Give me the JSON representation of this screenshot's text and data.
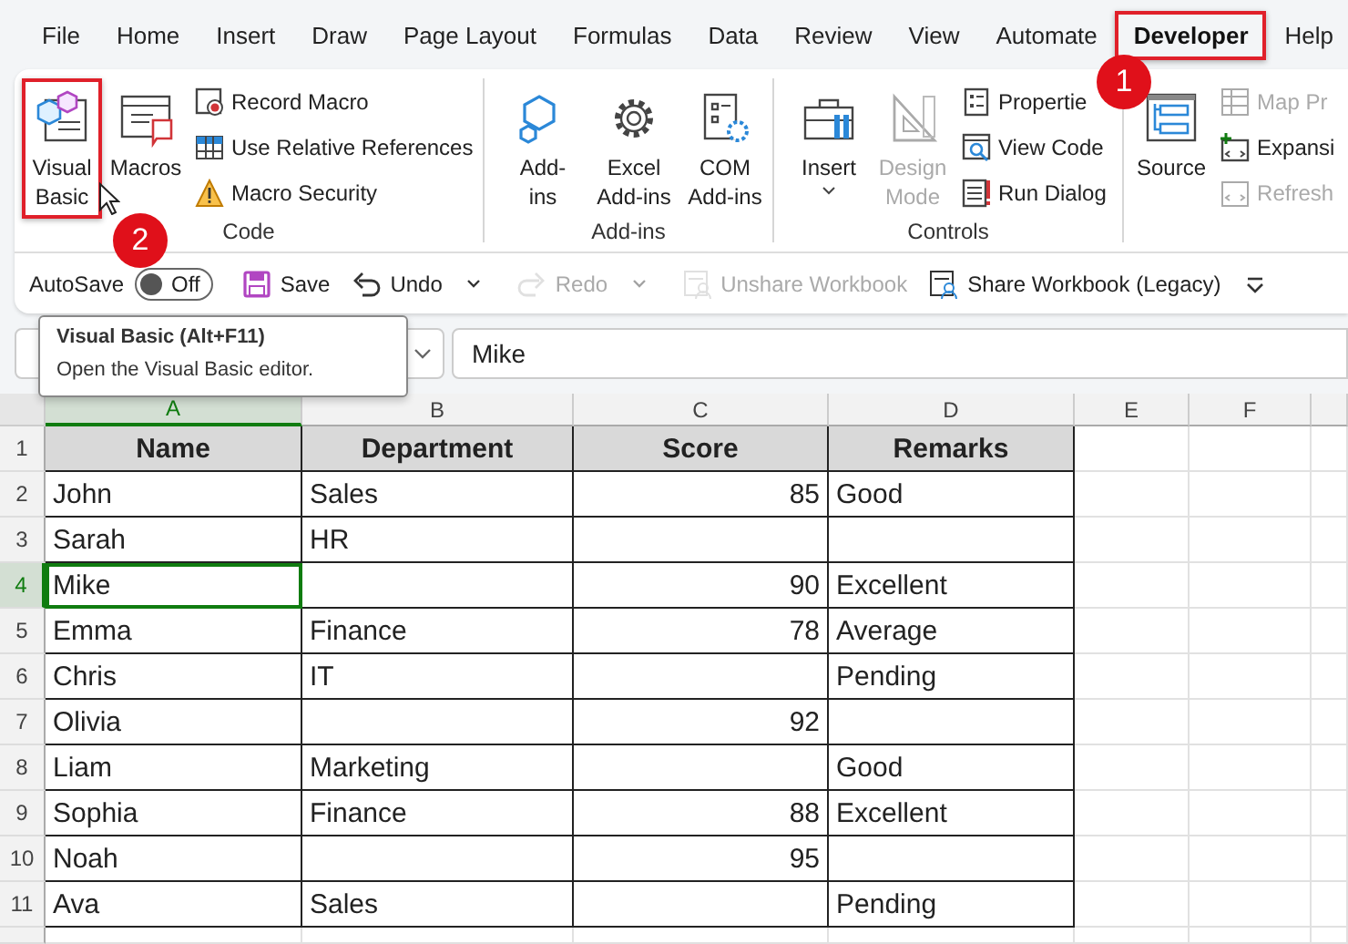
{
  "ribbon_tabs": [
    {
      "label": "File",
      "selected": false,
      "highlighted": false
    },
    {
      "label": "Home",
      "selected": false,
      "highlighted": false
    },
    {
      "label": "Insert",
      "selected": false,
      "highlighted": false
    },
    {
      "label": "Draw",
      "selected": false,
      "highlighted": false
    },
    {
      "label": "Page Layout",
      "selected": false,
      "highlighted": false
    },
    {
      "label": "Formulas",
      "selected": false,
      "highlighted": false
    },
    {
      "label": "Data",
      "selected": false,
      "highlighted": false
    },
    {
      "label": "Review",
      "selected": false,
      "highlighted": false
    },
    {
      "label": "View",
      "selected": false,
      "highlighted": false
    },
    {
      "label": "Automate",
      "selected": false,
      "highlighted": false
    },
    {
      "label": "Developer",
      "selected": true,
      "highlighted": true
    },
    {
      "label": "Help",
      "selected": false,
      "highlighted": false
    }
  ],
  "ribbon_groups": [
    {
      "label": "Code",
      "items": [
        {
          "kind": "large",
          "label": "Visual\nBasic",
          "highlighted": true,
          "disabled": false,
          "dropdown": false
        },
        {
          "kind": "large",
          "label": "Macros",
          "highlighted": false,
          "disabled": false,
          "dropdown": false
        },
        {
          "kind": "small",
          "label": "Record Macro",
          "highlighted": false,
          "disabled": false,
          "dropdown": false
        },
        {
          "kind": "small",
          "label": "Use Relative References",
          "highlighted": false,
          "disabled": false,
          "dropdown": false
        },
        {
          "kind": "small",
          "label": "Macro Security",
          "highlighted": false,
          "disabled": false,
          "dropdown": false
        }
      ]
    },
    {
      "label": "Add-ins",
      "items": [
        {
          "kind": "large",
          "label": "Add-\nins",
          "highlighted": false,
          "disabled": false,
          "dropdown": false
        },
        {
          "kind": "large",
          "label": "Excel\nAdd-ins",
          "highlighted": false,
          "disabled": false,
          "dropdown": false
        },
        {
          "kind": "large",
          "label": "COM\nAdd-ins",
          "highlighted": false,
          "disabled": false,
          "dropdown": false
        }
      ]
    },
    {
      "label": "Controls",
      "items": [
        {
          "kind": "large",
          "label": "Insert",
          "highlighted": false,
          "disabled": false,
          "dropdown": true
        },
        {
          "kind": "large",
          "label": "Design\nMode",
          "highlighted": false,
          "disabled": true,
          "dropdown": false
        },
        {
          "kind": "small",
          "label": "Propertie",
          "highlighted": false,
          "disabled": false,
          "dropdown": false
        },
        {
          "kind": "small",
          "label": "View Code",
          "highlighted": false,
          "disabled": false,
          "dropdown": false
        },
        {
          "kind": "small",
          "label": "Run Dialog",
          "highlighted": false,
          "disabled": false,
          "dropdown": false
        }
      ]
    },
    {
      "items": [
        {
          "kind": "large",
          "label": "Source",
          "highlighted": false,
          "disabled": false,
          "dropdown": false
        },
        {
          "kind": "small",
          "label": "Map Pr",
          "highlighted": false,
          "disabled": true,
          "dropdown": false
        },
        {
          "kind": "small",
          "label": "Expansi",
          "highlighted": false,
          "disabled": false,
          "dropdown": false
        },
        {
          "kind": "small",
          "label": "Refresh",
          "highlighted": false,
          "disabled": true,
          "dropdown": false
        }
      ]
    }
  ],
  "quick_access": {
    "autosave_label": "AutoSave",
    "autosave_toggle": {
      "on": false,
      "label": "Off"
    },
    "buttons": [
      {
        "kind": "save",
        "label": "Save",
        "disabled": false,
        "dropdown": false
      },
      {
        "kind": "undo",
        "label": "Undo",
        "disabled": false,
        "dropdown": true
      },
      {
        "kind": "redo",
        "label": "Redo",
        "disabled": true,
        "dropdown": true
      },
      {
        "kind": "unshare",
        "label": "Unshare Workbook",
        "disabled": true,
        "dropdown": false
      },
      {
        "kind": "share",
        "label": "Share Workbook (Legacy)",
        "disabled": false,
        "dropdown": false
      },
      {
        "kind": "customize",
        "disabled": false,
        "dropdown": false
      }
    ]
  },
  "formula_bar": {
    "value": "Mike"
  },
  "tooltip": {
    "title": "Visual Basic (Alt+F11)",
    "description": "Open the Visual Basic editor."
  },
  "callouts": [
    {
      "number": "1"
    },
    {
      "number": "2"
    }
  ],
  "sheet": {
    "columns": [
      {
        "label": "A",
        "selected": true
      },
      {
        "label": "B",
        "selected": false
      },
      {
        "label": "C",
        "selected": false
      },
      {
        "label": "D",
        "selected": false
      },
      {
        "label": "E",
        "selected": false
      },
      {
        "label": "F",
        "selected": false
      }
    ],
    "rows": [
      {
        "number": "1",
        "kind": "header",
        "selected": false,
        "cells": {
          "A": "Name",
          "B": "Department",
          "C": "Score",
          "D": "Remarks"
        }
      },
      {
        "number": "2",
        "kind": "data",
        "selected": false,
        "cells": {
          "A": "John",
          "B": "Sales",
          "C": "85",
          "D": "Good"
        }
      },
      {
        "number": "3",
        "kind": "data",
        "selected": false,
        "cells": {
          "A": "Sarah",
          "B": "HR"
        }
      },
      {
        "number": "4",
        "kind": "data",
        "selected": true,
        "cells": {
          "A": "Mike",
          "C": "90",
          "D": "Excellent"
        }
      },
      {
        "number": "5",
        "kind": "data",
        "selected": false,
        "cells": {
          "A": "Emma",
          "B": "Finance",
          "C": "78",
          "D": "Average"
        }
      },
      {
        "number": "6",
        "kind": "data",
        "selected": false,
        "cells": {
          "A": "Chris",
          "B": "IT",
          "D": "Pending"
        }
      },
      {
        "number": "7",
        "kind": "data",
        "selected": false,
        "cells": {
          "A": "Olivia",
          "C": "92"
        }
      },
      {
        "number": "8",
        "kind": "data",
        "selected": false,
        "cells": {
          "A": "Liam",
          "B": "Marketing",
          "D": "Good"
        }
      },
      {
        "number": "9",
        "kind": "data",
        "selected": false,
        "cells": {
          "A": "Sophia",
          "B": "Finance",
          "C": "88",
          "D": "Excellent"
        }
      },
      {
        "number": "10",
        "kind": "data",
        "selected": false,
        "cells": {
          "A": "Noah",
          "C": "95"
        }
      },
      {
        "number": "11",
        "kind": "data",
        "selected": false,
        "cells": {
          "A": "Ava",
          "B": "Sales",
          "D": "Pending"
        }
      }
    ]
  }
}
